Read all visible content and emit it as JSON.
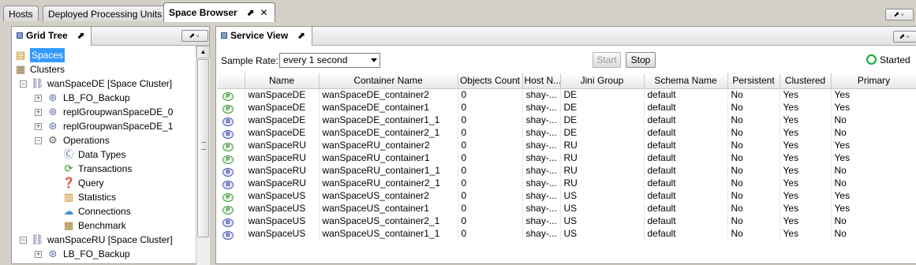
{
  "top_tabs": [
    {
      "label": "Hosts"
    },
    {
      "label": "Deployed Processing Units"
    },
    {
      "label": "Space Browser",
      "tools": "⬈ ✕"
    }
  ],
  "window_controls": {
    "pin": "⬈",
    "max": "▫"
  },
  "grid_tree": {
    "title": "Grid Tree",
    "pin": "⬈",
    "items": [
      {
        "label": "Spaces",
        "icon": "spaces-icon"
      },
      {
        "label": "Clusters",
        "icon": "clusters-icon"
      },
      {
        "label": "wanSpaceDE [Space Cluster]",
        "icon": "space-cluster-icon"
      },
      {
        "label": "LB_FO_Backup",
        "icon": "space-instance-icon"
      },
      {
        "label": "replGroupwanSpaceDE_0",
        "icon": "space-instance-icon"
      },
      {
        "label": "replGroupwanSpaceDE_1",
        "icon": "space-instance-icon"
      },
      {
        "label": "Operations",
        "icon": "operations-icon"
      },
      {
        "label": "Data Types",
        "icon": "data-types-icon"
      },
      {
        "label": "Transactions",
        "icon": "transactions-icon"
      },
      {
        "label": "Query",
        "icon": "query-icon"
      },
      {
        "label": "Statistics",
        "icon": "statistics-icon"
      },
      {
        "label": "Connections",
        "icon": "connections-icon"
      },
      {
        "label": "Benchmark",
        "icon": "benchmark-icon"
      },
      {
        "label": "wanSpaceRU [Space Cluster]",
        "icon": "space-cluster-icon"
      },
      {
        "label": "LB_FO_Backup",
        "icon": "space-instance-icon"
      }
    ]
  },
  "service_view": {
    "title": "Service View",
    "pin": "⬈",
    "sample_rate_label": "Sample Rate:",
    "sample_rate_value": "every 1 second",
    "start_label": "Start",
    "stop_label": "Stop",
    "status_label": "Started",
    "status_color": "#12a83a",
    "columns": [
      "",
      "Name",
      "Container Name",
      "Objects Count",
      "Host N...",
      "Jini Group",
      "Schema Name",
      "Persistent",
      "Clustered",
      "Primary"
    ],
    "rows": [
      {
        "role": "P",
        "name": "wanSpaceDE",
        "container": "wanSpaceDE_container2",
        "objects": "0",
        "host": "shay-...",
        "jini": "DE",
        "schema": "default",
        "persistent": "No",
        "clustered": "Yes",
        "primary": "Yes"
      },
      {
        "role": "P",
        "name": "wanSpaceDE",
        "container": "wanSpaceDE_container1",
        "objects": "0",
        "host": "shay-...",
        "jini": "DE",
        "schema": "default",
        "persistent": "No",
        "clustered": "Yes",
        "primary": "Yes"
      },
      {
        "role": "B",
        "name": "wanSpaceDE",
        "container": "wanSpaceDE_container1_1",
        "objects": "0",
        "host": "shay-...",
        "jini": "DE",
        "schema": "default",
        "persistent": "No",
        "clustered": "Yes",
        "primary": "No"
      },
      {
        "role": "B",
        "name": "wanSpaceDE",
        "container": "wanSpaceDE_container2_1",
        "objects": "0",
        "host": "shay-...",
        "jini": "DE",
        "schema": "default",
        "persistent": "No",
        "clustered": "Yes",
        "primary": "No"
      },
      {
        "role": "P",
        "name": "wanSpaceRU",
        "container": "wanSpaceRU_container2",
        "objects": "0",
        "host": "shay-...",
        "jini": "RU",
        "schema": "default",
        "persistent": "No",
        "clustered": "Yes",
        "primary": "Yes"
      },
      {
        "role": "P",
        "name": "wanSpaceRU",
        "container": "wanSpaceRU_container1",
        "objects": "0",
        "host": "shay-...",
        "jini": "RU",
        "schema": "default",
        "persistent": "No",
        "clustered": "Yes",
        "primary": "Yes"
      },
      {
        "role": "B",
        "name": "wanSpaceRU",
        "container": "wanSpaceRU_container1_1",
        "objects": "0",
        "host": "shay-...",
        "jini": "RU",
        "schema": "default",
        "persistent": "No",
        "clustered": "Yes",
        "primary": "No"
      },
      {
        "role": "B",
        "name": "wanSpaceRU",
        "container": "wanSpaceRU_container2_1",
        "objects": "0",
        "host": "shay-...",
        "jini": "RU",
        "schema": "default",
        "persistent": "No",
        "clustered": "Yes",
        "primary": "No"
      },
      {
        "role": "P",
        "name": "wanSpaceUS",
        "container": "wanSpaceUS_container2",
        "objects": "0",
        "host": "shay-...",
        "jini": "US",
        "schema": "default",
        "persistent": "No",
        "clustered": "Yes",
        "primary": "Yes"
      },
      {
        "role": "P",
        "name": "wanSpaceUS",
        "container": "wanSpaceUS_container1",
        "objects": "0",
        "host": "shay-...",
        "jini": "US",
        "schema": "default",
        "persistent": "No",
        "clustered": "Yes",
        "primary": "Yes"
      },
      {
        "role": "B",
        "name": "wanSpaceUS",
        "container": "wanSpaceUS_container2_1",
        "objects": "0",
        "host": "shay-...",
        "jini": "US",
        "schema": "default",
        "persistent": "No",
        "clustered": "Yes",
        "primary": "No"
      },
      {
        "role": "B",
        "name": "wanSpaceUS",
        "container": "wanSpaceUS_container1_1",
        "objects": "0",
        "host": "shay-...",
        "jini": "US",
        "schema": "default",
        "persistent": "No",
        "clustered": "Yes",
        "primary": "No"
      }
    ]
  }
}
